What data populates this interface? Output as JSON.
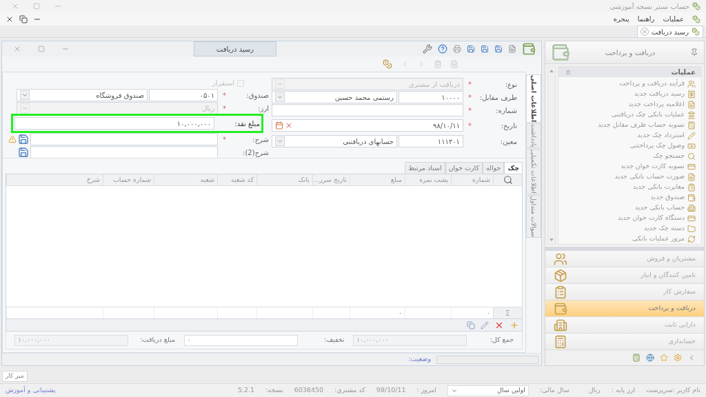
{
  "app_title": "حساب سنتر نسخه آموزشی",
  "menu": [
    {
      "label": "عملیات"
    },
    {
      "label": "راهنما"
    },
    {
      "label": "پنجره"
    }
  ],
  "doc_tabs": [
    {
      "label": "رسید دریافت",
      "selected": true
    }
  ],
  "form_window": {
    "title": "رسید دریافت",
    "side_tabs": [
      {
        "label": "اطلاعات اصلی",
        "selected": true
      },
      {
        "label": "یادداشت",
        "selected": false
      },
      {
        "label": "اطلاعات تکمیلی",
        "selected": false
      },
      {
        "label": "سوالات متداول",
        "selected": false
      }
    ],
    "right_fields": [
      {
        "kind": "select",
        "label": "نوع:",
        "mark": "*",
        "value": "دریافت از مشتری",
        "disabled": true
      },
      {
        "kind": "code_select",
        "label": "طرف مقابل:",
        "mark": "*",
        "code": "۱۰۰۰۰",
        "value": "رستمی محمد حسین",
        "disabled": false
      },
      {
        "kind": "text",
        "label": "شماره:",
        "mark": "*",
        "disabled": false
      },
      {
        "kind": "date",
        "label": "تاریخ:",
        "mark": "*",
        "value": "۹۸/۱۰/۱۱",
        "disabled": false
      },
      {
        "kind": "code_select",
        "label": "معین:",
        "code": "۱۱۱۲۰۱",
        "value": "حسابهای دریافتنی",
        "disabled": false
      }
    ],
    "left_fields": [
      {
        "kind": "checkbox",
        "label": "استقرار",
        "checked": false,
        "disabled": true
      },
      {
        "kind": "code_select",
        "label": "صندوق:",
        "mark": "*",
        "code": "۰۵۰۱",
        "value": "صندوق فروشگاه",
        "disabled": false
      },
      {
        "kind": "select",
        "label": "ارز:",
        "mark": "*",
        "value": "ریال",
        "disabled": true
      },
      {
        "kind": "text",
        "label": "مبلغ نقد:",
        "value": "۱۰,۰۰۰,۰۰۰",
        "highlighted": true,
        "disabled": false
      },
      {
        "kind": "memo",
        "label": "شرح:",
        "mark": "*",
        "warning": true,
        "disabled": false
      },
      {
        "kind": "memo",
        "label": "شرح(2):",
        "warning": false,
        "disabled": false
      }
    ],
    "grid_tabs": [
      {
        "label": "چک",
        "selected": true
      },
      {
        "label": "حواله",
        "selected": false
      },
      {
        "label": "کارت خوان",
        "selected": false
      },
      {
        "label": "اسناد مرتبط",
        "selected": false
      }
    ],
    "columns": [
      {
        "label": "شماره",
        "sum": "۰"
      },
      {
        "label": "پشت نمره"
      },
      {
        "label": "مبلغ",
        "sum": "۰"
      },
      {
        "label": "تاریخ سرر..."
      },
      {
        "label": "بانک"
      },
      {
        "label": "کد شعبه"
      },
      {
        "label": "شعبه"
      },
      {
        "label": "شماره حساب"
      },
      {
        "label": "شرح"
      }
    ],
    "sum_symbol": "Σ",
    "totals": [
      {
        "label": "جمع کل:",
        "value": "۱۰,۰۰۰,۰۰۰",
        "disabled": true
      },
      {
        "label": "تخفیف:",
        "value": "۰",
        "disabled": false
      },
      {
        "label": "مبلغ دریافت:",
        "value": "۱۰,۰۰۰,۰۰۰",
        "disabled": true
      }
    ],
    "status_label": "وضعیت:"
  },
  "side_panel": {
    "title": "دریافت و پرداخت",
    "group": "عملیات",
    "items": [
      {
        "label": "فرآیند دریافت و پرداخت"
      },
      {
        "label": "رسید دریافت جدید"
      },
      {
        "label": "اعلامیه پرداخت جدید"
      },
      {
        "label": "عملیات بانکی چک دریافتنی"
      },
      {
        "label": "تسویه حساب طرف مقابل جدید"
      },
      {
        "label": "استرداد چک جدید"
      },
      {
        "label": "وصول چک پرداختنی"
      },
      {
        "label": "جستجو چک"
      },
      {
        "label": "تسویه کارت خوان جدید"
      },
      {
        "label": "صورت حساب بانکی جدید"
      },
      {
        "label": "مغایرت بانکی جدید"
      },
      {
        "label": "صندوق جدید"
      },
      {
        "label": "حساب بانکی جدید"
      },
      {
        "label": "دستگاه کارت خوان جدید"
      },
      {
        "label": "دسته چک جدید"
      },
      {
        "label": "مرور عملیات بانکی"
      }
    ],
    "modules": [
      {
        "label": "مشتریان و فروش",
        "selected": false
      },
      {
        "label": "تامین کنندگان و انبار",
        "selected": false
      },
      {
        "label": "سفارش کار",
        "selected": false
      },
      {
        "label": "دریافت و پرداخت",
        "selected": true
      },
      {
        "label": "دارایی ثابت",
        "selected": false
      },
      {
        "label": "حسابداری",
        "selected": false
      }
    ]
  },
  "taskbar": {
    "button": "میز کار"
  },
  "status_bar": {
    "user": "نام کاربر :سرپرست",
    "currency_label": "ارز پایه :",
    "currency": "ریال",
    "year_label": "سال مالی:",
    "year": "اولین سال",
    "today_label": "امروز :",
    "today": "98/10/11",
    "customer_label": "کد مشتری:",
    "customer": "6038450",
    "version_label": "نسخه:",
    "version": "5.2.1",
    "support_link": "پشتیبانی و آموزش"
  }
}
